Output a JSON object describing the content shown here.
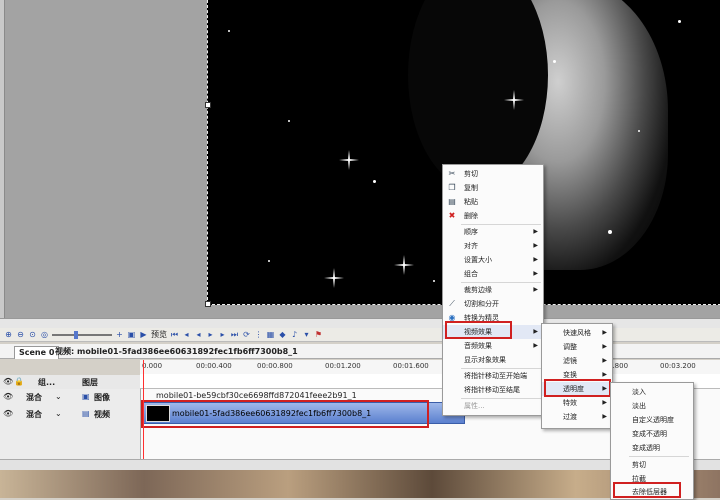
{
  "scene_tab": "Scene 0",
  "timeline_title": "视频: mobile01-5fad386ee60631892fec1fb6ff7300b8_1",
  "toolbar": {
    "preview_label": "预览"
  },
  "track_header": {
    "group_label": "组...",
    "layer_label": "图层"
  },
  "tracks": [
    {
      "mode": "混合",
      "type": "图像",
      "clip": "mobile01-be59cbf30ce6698ffd872041feee2b91_1"
    },
    {
      "mode": "混合",
      "type": "视频",
      "clip": "mobile01-5fad386ee60631892fec1fb6ff7300b8_1"
    }
  ],
  "ruler_ticks": [
    "0.000",
    "00:00.400",
    "00:00.800",
    "00:01.200",
    "00:01.600",
    "1.800",
    "00:03.200"
  ],
  "context_menu": {
    "items": [
      "剪切",
      "复制",
      "粘贴",
      "删除",
      "顺序",
      "对齐",
      "设置大小",
      "组合",
      "裁剪边缘",
      "切割和分开",
      "转换为精灵",
      "视频效果",
      "音频效果",
      "显示对象效果",
      "将指针移动至开始端",
      "将指针移动至结尾",
      "属性..."
    ]
  },
  "effects_menu": {
    "items": [
      "快速风格",
      "调整",
      "滤镜",
      "变换",
      "透明度",
      "特效",
      "过渡"
    ]
  },
  "transparency_menu": {
    "items": [
      "淡入",
      "淡出",
      "自定义透明度",
      "变成不透明",
      "变成透明",
      "剪切",
      "拉截",
      "去除低层器"
    ]
  },
  "colors": {
    "highlight": "#d02020",
    "clip_blue": "#5b80cf"
  }
}
